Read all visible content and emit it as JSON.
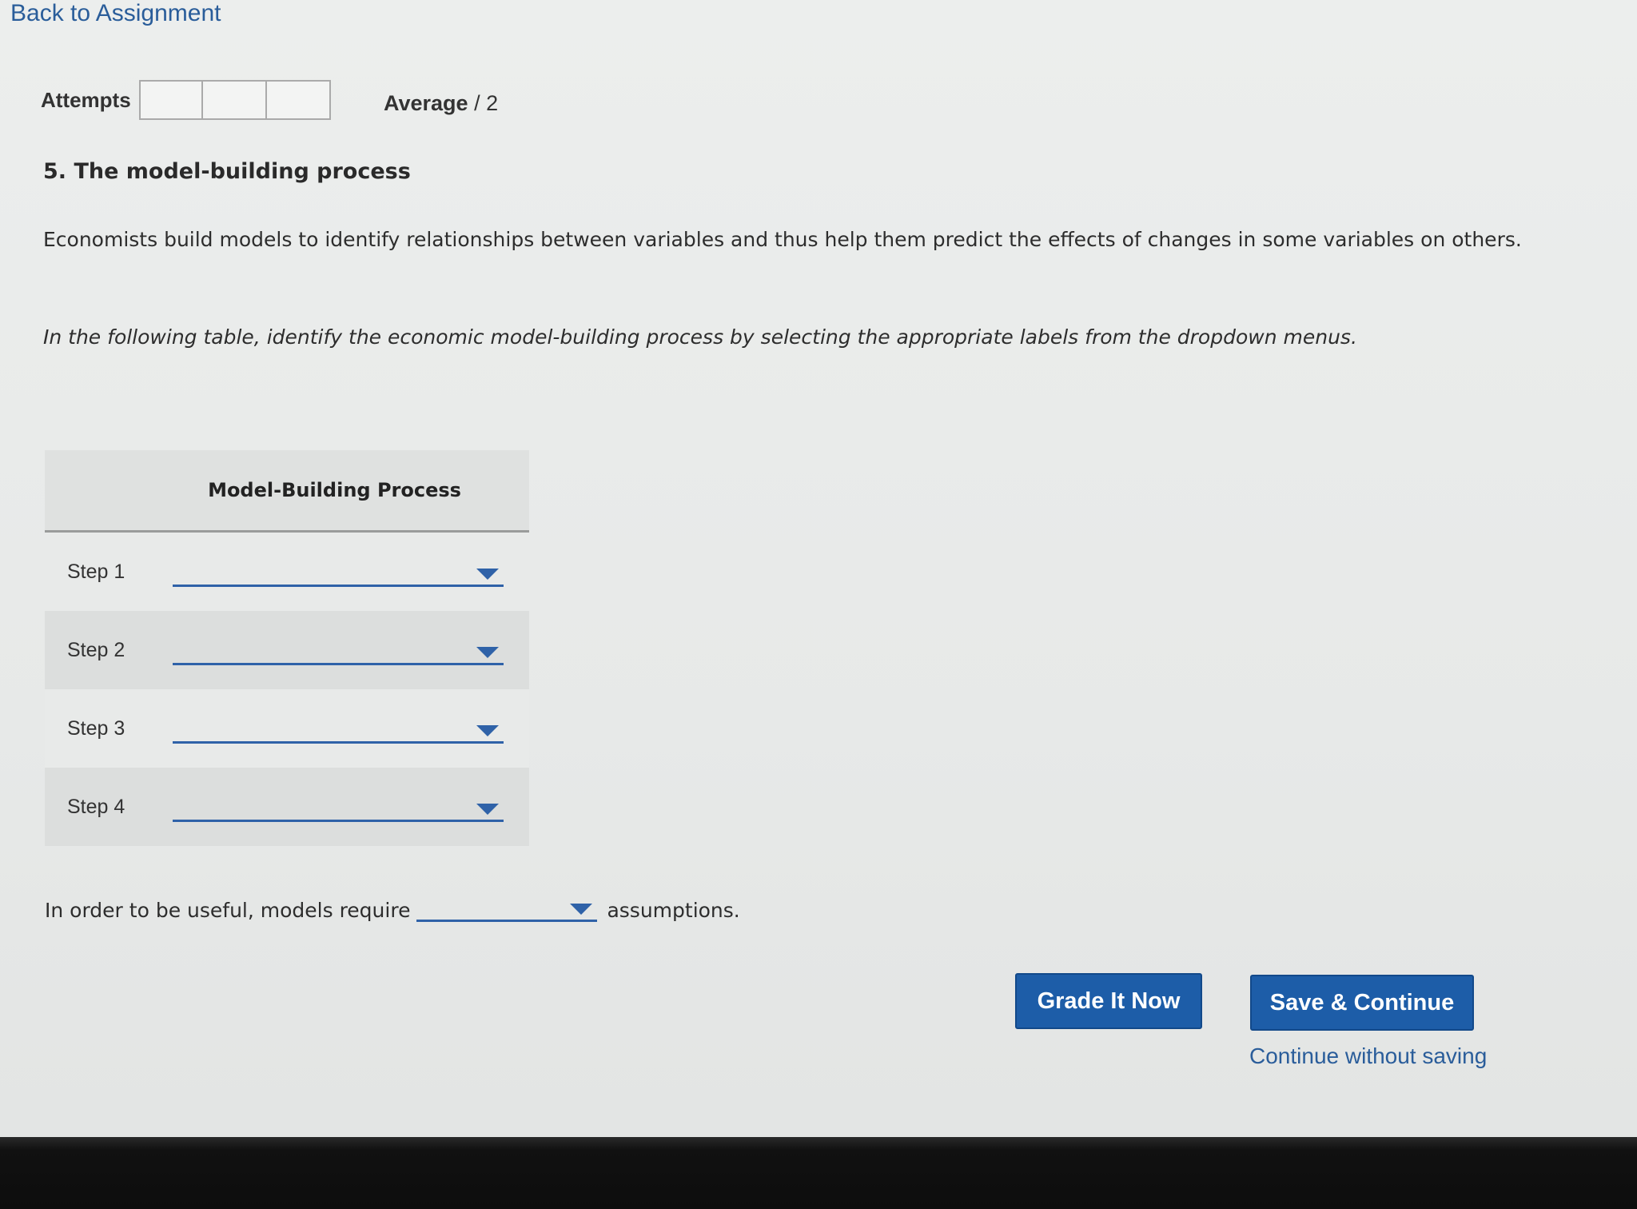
{
  "nav": {
    "back_label": "Back to Assignment"
  },
  "attempts": {
    "label": "Attempts",
    "boxes": [
      "",
      "",
      ""
    ]
  },
  "score": {
    "average_label": "Average",
    "average_suffix": " / 2"
  },
  "question": {
    "title": "5. The model-building process",
    "intro": "Economists build models to identify relationships between variables and thus help them predict the effects of changes in some variables on others.",
    "instructions": "In the following table, identify the economic model-building process by selecting the appropriate labels from the dropdown menus."
  },
  "table": {
    "header": "Model-Building Process",
    "rows": [
      {
        "label": "Step 1",
        "selected": ""
      },
      {
        "label": "Step 2",
        "selected": ""
      },
      {
        "label": "Step 3",
        "selected": ""
      },
      {
        "label": "Step 4",
        "selected": ""
      }
    ]
  },
  "sentence": {
    "before": "In order to be useful, models require",
    "selected": "",
    "after": "assumptions."
  },
  "actions": {
    "grade_label": "Grade It Now",
    "save_label": "Save & Continue",
    "continue_label": "Continue without saving"
  },
  "colors": {
    "link": "#2a5d9a",
    "button": "#1d5da8",
    "dropdown_accent": "#2f62a8"
  }
}
